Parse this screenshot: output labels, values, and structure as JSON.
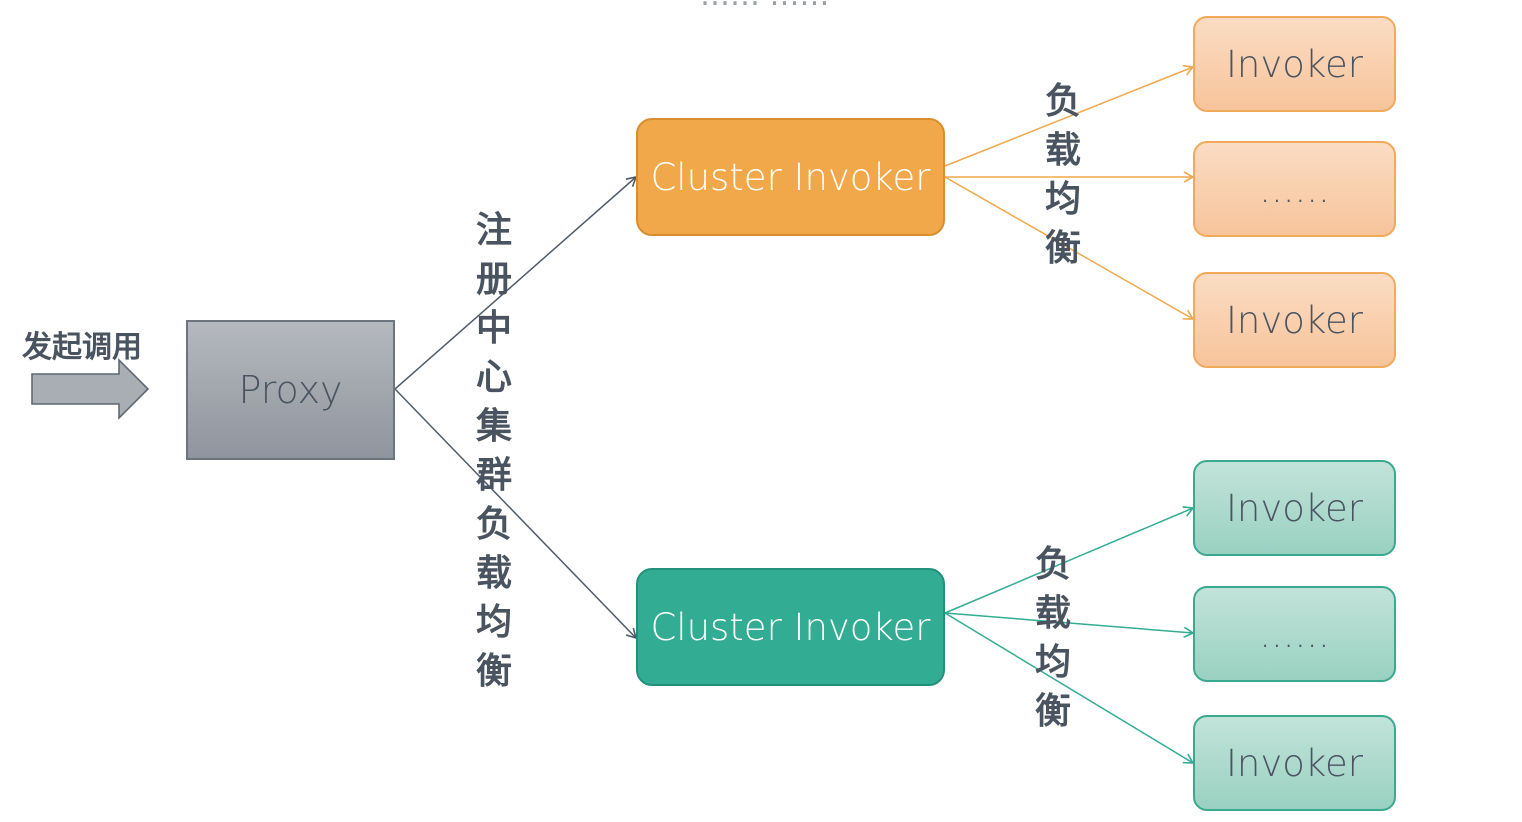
{
  "title_fragment": "…… ……",
  "start": {
    "label": "发起调用"
  },
  "proxy": {
    "label": "Proxy"
  },
  "registry_label": "注册中心集群负载均衡",
  "clusters": [
    {
      "label": "Cluster Invoker",
      "color": "#f0a84a",
      "edge_color": "#f0a84a",
      "lb_label": "负载均衡",
      "invokers": [
        "Invoker",
        "......",
        "Invoker"
      ]
    },
    {
      "label": "Cluster Invoker",
      "color": "#33ac94",
      "edge_color": "#33ac94",
      "lb_label": "负载均衡",
      "invokers": [
        "Invoker",
        "......",
        "Invoker"
      ]
    }
  ],
  "colors": {
    "proxy_edge": "#4f5a68",
    "text": "#4a5460"
  }
}
